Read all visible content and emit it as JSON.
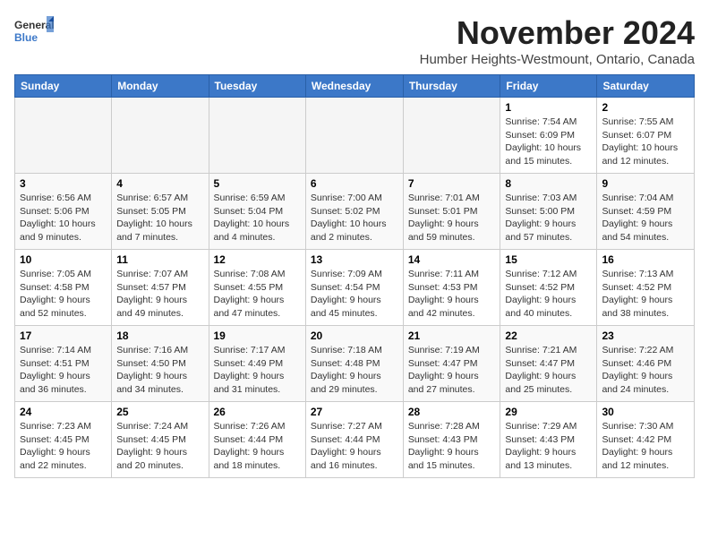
{
  "header": {
    "logo_line1": "General",
    "logo_line2": "Blue",
    "month": "November 2024",
    "location": "Humber Heights-Westmount, Ontario, Canada"
  },
  "days_of_week": [
    "Sunday",
    "Monday",
    "Tuesday",
    "Wednesday",
    "Thursday",
    "Friday",
    "Saturday"
  ],
  "weeks": [
    [
      {
        "day": "",
        "info": ""
      },
      {
        "day": "",
        "info": ""
      },
      {
        "day": "",
        "info": ""
      },
      {
        "day": "",
        "info": ""
      },
      {
        "day": "",
        "info": ""
      },
      {
        "day": "1",
        "info": "Sunrise: 7:54 AM\nSunset: 6:09 PM\nDaylight: 10 hours and 15 minutes."
      },
      {
        "day": "2",
        "info": "Sunrise: 7:55 AM\nSunset: 6:07 PM\nDaylight: 10 hours and 12 minutes."
      }
    ],
    [
      {
        "day": "3",
        "info": "Sunrise: 6:56 AM\nSunset: 5:06 PM\nDaylight: 10 hours and 9 minutes."
      },
      {
        "day": "4",
        "info": "Sunrise: 6:57 AM\nSunset: 5:05 PM\nDaylight: 10 hours and 7 minutes."
      },
      {
        "day": "5",
        "info": "Sunrise: 6:59 AM\nSunset: 5:04 PM\nDaylight: 10 hours and 4 minutes."
      },
      {
        "day": "6",
        "info": "Sunrise: 7:00 AM\nSunset: 5:02 PM\nDaylight: 10 hours and 2 minutes."
      },
      {
        "day": "7",
        "info": "Sunrise: 7:01 AM\nSunset: 5:01 PM\nDaylight: 9 hours and 59 minutes."
      },
      {
        "day": "8",
        "info": "Sunrise: 7:03 AM\nSunset: 5:00 PM\nDaylight: 9 hours and 57 minutes."
      },
      {
        "day": "9",
        "info": "Sunrise: 7:04 AM\nSunset: 4:59 PM\nDaylight: 9 hours and 54 minutes."
      }
    ],
    [
      {
        "day": "10",
        "info": "Sunrise: 7:05 AM\nSunset: 4:58 PM\nDaylight: 9 hours and 52 minutes."
      },
      {
        "day": "11",
        "info": "Sunrise: 7:07 AM\nSunset: 4:57 PM\nDaylight: 9 hours and 49 minutes."
      },
      {
        "day": "12",
        "info": "Sunrise: 7:08 AM\nSunset: 4:55 PM\nDaylight: 9 hours and 47 minutes."
      },
      {
        "day": "13",
        "info": "Sunrise: 7:09 AM\nSunset: 4:54 PM\nDaylight: 9 hours and 45 minutes."
      },
      {
        "day": "14",
        "info": "Sunrise: 7:11 AM\nSunset: 4:53 PM\nDaylight: 9 hours and 42 minutes."
      },
      {
        "day": "15",
        "info": "Sunrise: 7:12 AM\nSunset: 4:52 PM\nDaylight: 9 hours and 40 minutes."
      },
      {
        "day": "16",
        "info": "Sunrise: 7:13 AM\nSunset: 4:52 PM\nDaylight: 9 hours and 38 minutes."
      }
    ],
    [
      {
        "day": "17",
        "info": "Sunrise: 7:14 AM\nSunset: 4:51 PM\nDaylight: 9 hours and 36 minutes."
      },
      {
        "day": "18",
        "info": "Sunrise: 7:16 AM\nSunset: 4:50 PM\nDaylight: 9 hours and 34 minutes."
      },
      {
        "day": "19",
        "info": "Sunrise: 7:17 AM\nSunset: 4:49 PM\nDaylight: 9 hours and 31 minutes."
      },
      {
        "day": "20",
        "info": "Sunrise: 7:18 AM\nSunset: 4:48 PM\nDaylight: 9 hours and 29 minutes."
      },
      {
        "day": "21",
        "info": "Sunrise: 7:19 AM\nSunset: 4:47 PM\nDaylight: 9 hours and 27 minutes."
      },
      {
        "day": "22",
        "info": "Sunrise: 7:21 AM\nSunset: 4:47 PM\nDaylight: 9 hours and 25 minutes."
      },
      {
        "day": "23",
        "info": "Sunrise: 7:22 AM\nSunset: 4:46 PM\nDaylight: 9 hours and 24 minutes."
      }
    ],
    [
      {
        "day": "24",
        "info": "Sunrise: 7:23 AM\nSunset: 4:45 PM\nDaylight: 9 hours and 22 minutes."
      },
      {
        "day": "25",
        "info": "Sunrise: 7:24 AM\nSunset: 4:45 PM\nDaylight: 9 hours and 20 minutes."
      },
      {
        "day": "26",
        "info": "Sunrise: 7:26 AM\nSunset: 4:44 PM\nDaylight: 9 hours and 18 minutes."
      },
      {
        "day": "27",
        "info": "Sunrise: 7:27 AM\nSunset: 4:44 PM\nDaylight: 9 hours and 16 minutes."
      },
      {
        "day": "28",
        "info": "Sunrise: 7:28 AM\nSunset: 4:43 PM\nDaylight: 9 hours and 15 minutes."
      },
      {
        "day": "29",
        "info": "Sunrise: 7:29 AM\nSunset: 4:43 PM\nDaylight: 9 hours and 13 minutes."
      },
      {
        "day": "30",
        "info": "Sunrise: 7:30 AM\nSunset: 4:42 PM\nDaylight: 9 hours and 12 minutes."
      }
    ]
  ]
}
